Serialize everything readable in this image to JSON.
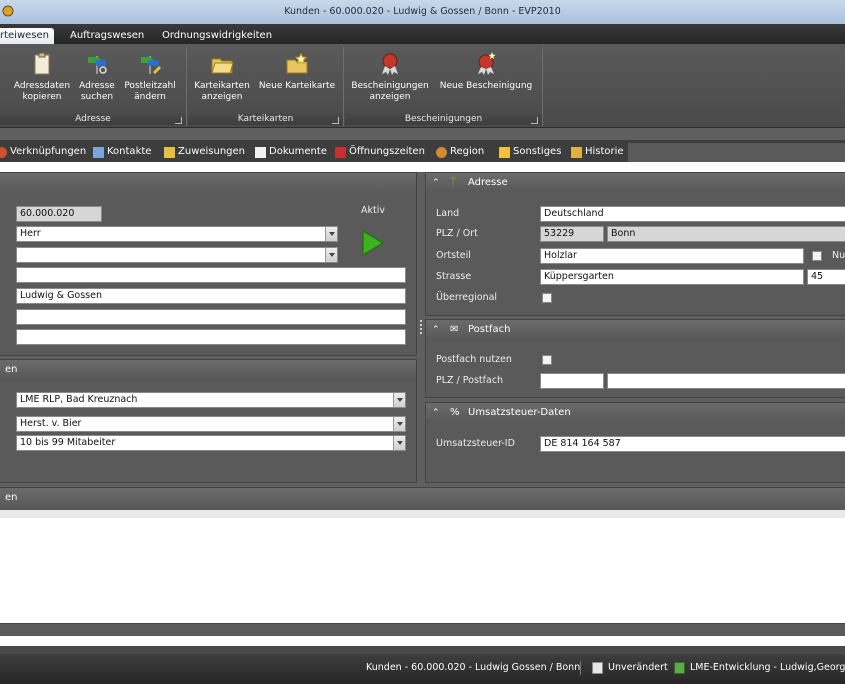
{
  "window": {
    "title": "Kunden - 60.000.020 - Ludwig & Gossen / Bonn - EVP2010"
  },
  "menu_tabs": [
    "rteiwesen",
    "Auftragswesen",
    "Ordnungswidrigkeiten"
  ],
  "ribbon": {
    "groups": [
      {
        "label": "Adresse",
        "buttons": [
          {
            "line1": "Adressdaten",
            "line2": "kopieren",
            "icon": "clipboard-icon"
          },
          {
            "line1": "Adresse",
            "line2": "suchen",
            "icon": "signpost-search-icon"
          },
          {
            "line1": "Postleitzahl",
            "line2": "ändern",
            "icon": "signpost-edit-icon"
          }
        ]
      },
      {
        "label": "Karteikarten",
        "buttons": [
          {
            "line1": "Karteikarten",
            "line2": "anzeigen",
            "icon": "folder-open-icon"
          },
          {
            "line1": "Neue Karteikarte",
            "line2": "",
            "icon": "new-card-icon"
          }
        ]
      },
      {
        "label": "Bescheinigungen",
        "buttons": [
          {
            "line1": "Bescheinigungen",
            "line2": "anzeigen",
            "icon": "certificate-seal-icon"
          },
          {
            "line1": "Neue Bescheinigung",
            "line2": "",
            "icon": "new-certificate-icon"
          }
        ]
      }
    ]
  },
  "nav_tabs": [
    {
      "label": "Verknüpfungen",
      "icon": "link-icon"
    },
    {
      "label": "Kontakte",
      "icon": "contacts-icon"
    },
    {
      "label": "Zuweisungen",
      "icon": "assign-icon"
    },
    {
      "label": "Dokumente",
      "icon": "document-icon"
    },
    {
      "label": "Öffnungszeiten",
      "icon": "calendar-icon"
    },
    {
      "label": "Region",
      "icon": "region-icon"
    },
    {
      "label": "Sonstiges",
      "icon": "misc-icon"
    },
    {
      "label": "Historie",
      "icon": "history-icon"
    }
  ],
  "left_top": {
    "number": "60.000.020",
    "anrede": "Herr",
    "titel": "",
    "name1": "",
    "name2": "Ludwig & Gossen",
    "name3": "",
    "name4": "",
    "aktiv_label": "Aktiv"
  },
  "left_mid": {
    "header": "en",
    "field1": "LME RLP, Bad Kreuznach",
    "field2": "Herst. v. Bier",
    "field3": "10 bis 99 Mitabeiter"
  },
  "left_bottom": {
    "header": "en"
  },
  "adresse": {
    "header": "Adresse",
    "land_label": "Land",
    "land": "Deutschland",
    "plzort_label": "PLZ / Ort",
    "plz": "53229",
    "ort": "Bonn",
    "ortsteil_label": "Ortsteil",
    "ortsteil": "Holzlar",
    "nu_label": "Nu",
    "strasse_label": "Strasse",
    "strasse": "Küppersgarten",
    "hausnr": "45",
    "ueberregional_label": "Überregional"
  },
  "postfach": {
    "header": "Postfach",
    "nutzen_label": "Postfach nutzen",
    "plz_label": "PLZ / Postfach",
    "plz": "",
    "postfach": ""
  },
  "ust": {
    "header": "Umsatzsteuer-Daten",
    "label": "Umsatzsteuer-ID",
    "value": "DE 814 164 587"
  },
  "status": {
    "context": "Kunden - 60.000.020 - Ludwig  Gossen / Bonn",
    "state": "Unverändert",
    "user": "LME-Entwicklung - Ludwig,Georg"
  }
}
